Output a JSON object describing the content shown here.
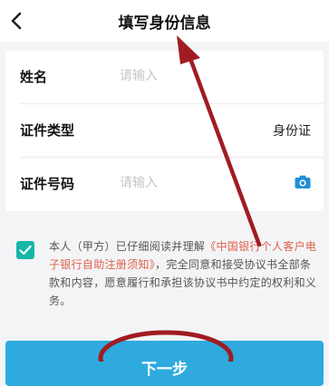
{
  "header": {
    "title": "填写身份信息",
    "back_icon": "chevron-left-icon"
  },
  "form": {
    "name": {
      "label": "姓名",
      "placeholder": "请输入",
      "value": ""
    },
    "id_type": {
      "label": "证件类型",
      "value": "身份证"
    },
    "id_number": {
      "label": "证件号码",
      "placeholder": "请输入",
      "value": "",
      "icon": "camera-icon"
    }
  },
  "agreement": {
    "checked": true,
    "text_prefix": "本人（甲方）已仔细阅读并理解",
    "link_text": "《中国银行个人客户电子银行自助注册须知》",
    "text_suffix": "，完全同意和接受协议书全部条款和内容，愿意履行和承担该协议书中约定的权利和义务。"
  },
  "footer": {
    "next_label": "下一步"
  },
  "colors": {
    "accent": "#2eaadf",
    "checkbox": "#17b6a7",
    "link": "#e0604c",
    "annotation": "#a01c22"
  }
}
